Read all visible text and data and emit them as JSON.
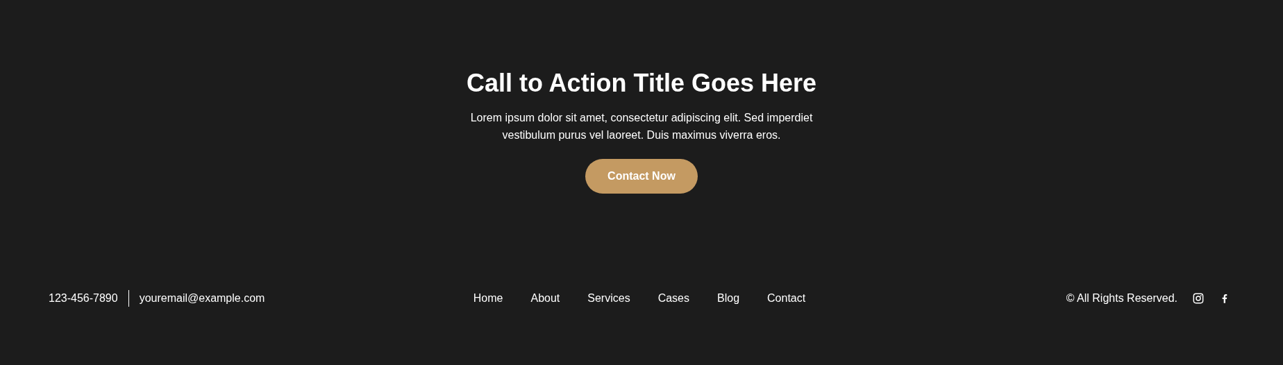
{
  "cta": {
    "title": "Call to Action Title Goes Here",
    "text": "Lorem ipsum dolor sit amet, consectetur adipiscing elit. Sed imperdiet vestibulum purus vel laoreet. Duis maximus viverra eros.",
    "button": "Contact Now"
  },
  "footer": {
    "phone": "123-456-7890",
    "email": "youremail@example.com",
    "nav": [
      "Home",
      "About",
      "Services",
      "Cases",
      "Blog",
      "Contact"
    ],
    "copyright": "© All Rights Reserved.",
    "social": [
      {
        "kind": "instagram"
      },
      {
        "kind": "facebook"
      }
    ]
  }
}
